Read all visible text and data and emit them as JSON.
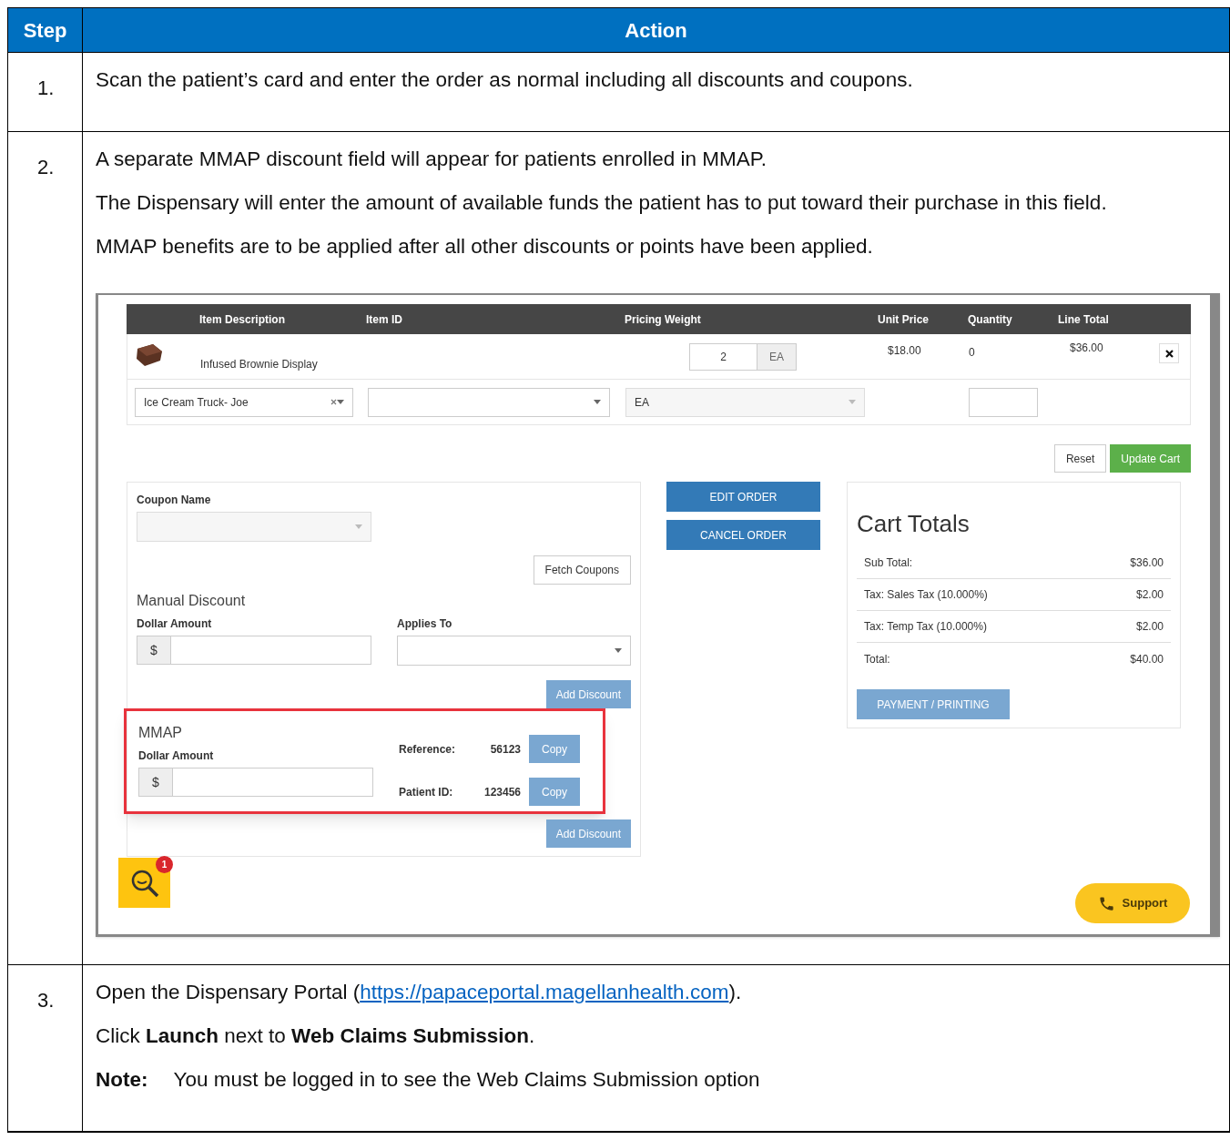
{
  "table": {
    "columns": [
      "Step",
      "Action"
    ],
    "rows": [
      {
        "step": "1.",
        "paragraphs": [
          {
            "kind": "text",
            "text": "Scan the patient’s card and enter the order as normal including all discounts and coupons."
          }
        ]
      },
      {
        "step": "2.",
        "paragraphs": [
          {
            "kind": "text",
            "text": "A separate MMAP discount field will appear for patients enrolled in MMAP."
          },
          {
            "kind": "text",
            "text": "The Dispensary will enter the amount of available funds the patient has to put toward their purchase in this field."
          },
          {
            "kind": "text",
            "text": "MMAP benefits are to be applied after all other discounts or points have been applied."
          },
          {
            "kind": "screenshot"
          }
        ]
      },
      {
        "step": "3.",
        "paragraphs": [
          {
            "kind": "link",
            "before": "Open the Dispensary Portal (",
            "link": "https://papaceportal.magellanhealth.com",
            "after": ")."
          },
          {
            "kind": "text",
            "text": "Click **Launch** next to **Web Claims Submission**."
          },
          {
            "kind": "note",
            "label": "Note:",
            "text": "You must be logged in to see the Web Claims Submission option"
          }
        ]
      }
    ]
  },
  "app": {
    "cart_table": {
      "columns": [
        "Item Description",
        "Item ID",
        "Pricing Weight",
        "Unit Price",
        "Quantity",
        "Line Total"
      ],
      "item": {
        "description": "Infused Brownie Display",
        "weight_value": "2",
        "weight_unit": "EA",
        "unit_price": "$18.00",
        "quantity": "0",
        "line_total": "$36.00"
      },
      "options": {
        "customer_select": "Ice Cream Truck- Joe",
        "unit_select": "EA"
      }
    },
    "cart_buttons": [
      "Reset",
      "Update Cart"
    ],
    "coupon": {
      "label": "Coupon Name",
      "fetch_button": "Fetch Coupons"
    },
    "manual_discount": {
      "title": "Manual Discount",
      "amount_label": "Dollar Amount",
      "currency": "$",
      "applies_label": "Applies To",
      "button": "Add Discount"
    },
    "mmap": {
      "title": "MMAP",
      "highlighted": true,
      "amount_label": "Dollar Amount",
      "currency": "$",
      "fields": [
        {
          "label": "Reference:",
          "value": "56123",
          "button": "Copy"
        },
        {
          "label": "Patient ID:",
          "value": "123456",
          "button": "Copy"
        }
      ],
      "button": "Add Discount"
    },
    "order_buttons": [
      "EDIT ORDER",
      "CANCEL ORDER"
    ],
    "cart_totals": {
      "title": "Cart Totals",
      "rows": [
        {
          "label": "Sub Total:",
          "value": "$36.00"
        },
        {
          "label": "Tax: Sales Tax (10.000%)",
          "value": "$2.00"
        },
        {
          "label": "Tax: Temp Tax (10.000%)",
          "value": "$2.00"
        },
        {
          "label": "Total:",
          "value": "$40.00"
        }
      ],
      "button": "PAYMENT / PRINTING"
    },
    "notification": {
      "badge": "1"
    },
    "support_button": "Support"
  }
}
